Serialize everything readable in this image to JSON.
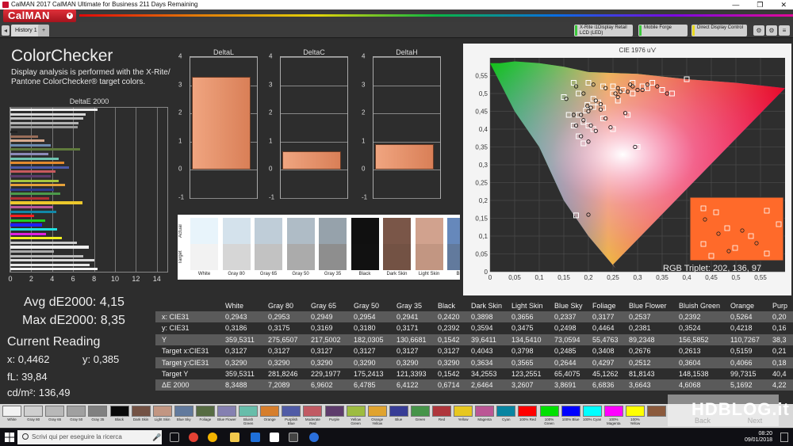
{
  "window": {
    "title": "CalMAN 2017 CalMAN Ultimate for Business 211 Days Remaining",
    "min": "—",
    "max": "❐",
    "close": "✕"
  },
  "app": {
    "logo": "CalMAN"
  },
  "tabs": [
    {
      "label": "History 1"
    },
    {
      "label": "+"
    }
  ],
  "devices": [
    {
      "label_line1": "X-Rite i1Display Retail",
      "label_line2": "LCD (LED)",
      "color": "#3cc83c"
    },
    {
      "label_line1": "Mobile Forge",
      "label_line2": "",
      "color": "#3cc83c"
    },
    {
      "label_line1": "Direct Display Control",
      "label_line2": "",
      "color": "#e8d81c"
    }
  ],
  "panel": {
    "title": "ColorChecker",
    "description": "Display analysis is performed with the X-Rite/ Pantone ColorChecker® target colors."
  },
  "de_chart": {
    "title": "DeltaE 2000",
    "xticks": [
      "0",
      "2",
      "4",
      "6",
      "8",
      "10",
      "12",
      "14"
    ],
    "xmax": 15,
    "bars": [
      {
        "value": 8.35,
        "color": "#f2f2f2"
      },
      {
        "value": 7.21,
        "color": "#d9d9d9"
      },
      {
        "value": 6.96,
        "color": "#c6c6c6"
      },
      {
        "value": 6.48,
        "color": "#b4b4b4"
      },
      {
        "value": 6.41,
        "color": "#9a9a9a"
      },
      {
        "value": 0.67,
        "color": "#222222"
      },
      {
        "value": 2.65,
        "color": "#9a6e5a"
      },
      {
        "value": 3.26,
        "color": "#d7a98f"
      },
      {
        "value": 3.87,
        "color": "#6e8bb0"
      },
      {
        "value": 6.68,
        "color": "#5f7a3c"
      },
      {
        "value": 3.66,
        "color": "#8c8ab8"
      },
      {
        "value": 4.61,
        "color": "#6fc4b0"
      },
      {
        "value": 5.17,
        "color": "#e48a2e"
      },
      {
        "value": 5.6,
        "color": "#4c5aa8"
      },
      {
        "value": 4.3,
        "color": "#c85a5e"
      },
      {
        "value": 3.9,
        "color": "#5c3c6c"
      },
      {
        "value": 4.6,
        "color": "#a6c640"
      },
      {
        "value": 5.2,
        "color": "#e6a23a"
      },
      {
        "value": 4.2,
        "color": "#2e3c8c"
      },
      {
        "value": 4.8,
        "color": "#4c9a4a"
      },
      {
        "value": 3.7,
        "color": "#b03234"
      },
      {
        "value": 6.9,
        "color": "#ecc82c"
      },
      {
        "value": 4.1,
        "color": "#bc5a98"
      },
      {
        "value": 4.4,
        "color": "#1288a8"
      },
      {
        "value": 2.3,
        "color": "#ff2020"
      },
      {
        "value": 3.3,
        "color": "#20d020"
      },
      {
        "value": 3.0,
        "color": "#2020ff"
      },
      {
        "value": 4.5,
        "color": "#20e0e0"
      },
      {
        "value": 3.4,
        "color": "#e020e0"
      },
      {
        "value": 4.9,
        "color": "#f0f020"
      },
      {
        "value": 6.4,
        "color": "#cccccc"
      },
      {
        "value": 7.5,
        "color": "#eeeeee"
      },
      {
        "value": 4.2,
        "color": "#aaaaaa"
      },
      {
        "value": 7.0,
        "color": "#bbbbbb"
      },
      {
        "value": 8.0,
        "color": "#dddddd"
      },
      {
        "value": 7.6,
        "color": "#e6e6e6"
      },
      {
        "value": 8.35,
        "color": "#f4f4f4"
      }
    ]
  },
  "stats": {
    "avg": "Avg dE2000: 4,15",
    "max": "Max dE2000: 8,35",
    "current_reading_title": "Current Reading",
    "x": "x: 0,4462",
    "y": "y: 0,385",
    "fl": "fL: 39,84",
    "cdm2": "cd/m²: 136,49"
  },
  "delta_charts": [
    {
      "title": "DeltaL",
      "value": 3.3,
      "ymin": -1,
      "ymax": 4,
      "yticks": [
        "4",
        "3",
        "2",
        "1",
        "0",
        "-1"
      ]
    },
    {
      "title": "DeltaC",
      "value": 0.65,
      "ymin": -1,
      "ymax": 4,
      "yticks": [
        "4",
        "3",
        "2",
        "1",
        "0",
        "-1"
      ]
    },
    {
      "title": "DeltaH",
      "value": 0.9,
      "ymin": -1,
      "ymax": 4,
      "yticks": [
        "4",
        "3",
        "2",
        "1",
        "0",
        "-1"
      ]
    }
  ],
  "swatches": {
    "actual_label": "Actual",
    "target_label": "Target",
    "items": [
      {
        "name": "White",
        "actual": "#e8f4fb",
        "target": "#f2f2f2"
      },
      {
        "name": "Gray 80",
        "actual": "#d4e2ec",
        "target": "#d6d6d6"
      },
      {
        "name": "Gray 65",
        "actual": "#bfcdd8",
        "target": "#c2c2c2"
      },
      {
        "name": "Gray 50",
        "actual": "#afbcc6",
        "target": "#ababab"
      },
      {
        "name": "Gray 35",
        "actual": "#96a2ab",
        "target": "#8e8e8e"
      },
      {
        "name": "Black",
        "actual": "#101010",
        "target": "#111111"
      },
      {
        "name": "Dark Skin",
        "actual": "#7a5648",
        "target": "#735244"
      },
      {
        "name": "Light Skin",
        "actual": "#d1a28e",
        "target": "#c29682"
      },
      {
        "name": "Blue",
        "actual": "#6688bb",
        "target": "#627a9d"
      }
    ]
  },
  "cie": {
    "title": "CIE 1976 u'v'",
    "xticks": [
      "0",
      "0,05",
      "0,1",
      "0,15",
      "0,2",
      "0,25",
      "0,3",
      "0,35",
      "0,4",
      "0,45",
      "0,5",
      "0,55"
    ],
    "yticks": [
      "0,55",
      "0,5",
      "0,45",
      "0,4",
      "0,35",
      "0,3",
      "0,25",
      "0,2",
      "0,15",
      "0,1",
      "0,05",
      "0"
    ],
    "xmax": 0.6,
    "ymax": 0.6,
    "rgb_triplet": "RGB Triplet: 202, 136, 97",
    "targets": [
      [
        0.198,
        0.468
      ],
      [
        0.21,
        0.462
      ],
      [
        0.195,
        0.452
      ],
      [
        0.21,
        0.485
      ],
      [
        0.22,
        0.475
      ],
      [
        0.18,
        0.44
      ],
      [
        0.19,
        0.42
      ],
      [
        0.16,
        0.44
      ],
      [
        0.17,
        0.41
      ],
      [
        0.2,
        0.41
      ],
      [
        0.23,
        0.43
      ],
      [
        0.21,
        0.4
      ],
      [
        0.18,
        0.38
      ],
      [
        0.19,
        0.36
      ],
      [
        0.25,
        0.5
      ],
      [
        0.27,
        0.51
      ],
      [
        0.23,
        0.52
      ],
      [
        0.29,
        0.53
      ],
      [
        0.32,
        0.515
      ],
      [
        0.35,
        0.51
      ],
      [
        0.4,
        0.54
      ],
      [
        0.15,
        0.49
      ],
      [
        0.17,
        0.53
      ],
      [
        0.26,
        0.48
      ],
      [
        0.29,
        0.5
      ],
      [
        0.31,
        0.52
      ],
      [
        0.33,
        0.53
      ],
      [
        0.37,
        0.5
      ],
      [
        0.25,
        0.52
      ],
      [
        0.2,
        0.53
      ],
      [
        0.18,
        0.5
      ],
      [
        0.28,
        0.44
      ],
      [
        0.3,
        0.35
      ],
      [
        0.25,
        0.4
      ],
      [
        0.23,
        0.46
      ],
      [
        0.175,
        0.158
      ]
    ],
    "measured": [
      [
        0.198,
        0.465
      ],
      [
        0.205,
        0.46
      ],
      [
        0.2,
        0.45
      ],
      [
        0.215,
        0.48
      ],
      [
        0.225,
        0.47
      ],
      [
        0.185,
        0.44
      ],
      [
        0.19,
        0.425
      ],
      [
        0.17,
        0.44
      ],
      [
        0.175,
        0.41
      ],
      [
        0.205,
        0.41
      ],
      [
        0.235,
        0.43
      ],
      [
        0.215,
        0.395
      ],
      [
        0.185,
        0.38
      ],
      [
        0.2,
        0.365
      ],
      [
        0.255,
        0.5
      ],
      [
        0.265,
        0.505
      ],
      [
        0.235,
        0.515
      ],
      [
        0.285,
        0.525
      ],
      [
        0.3,
        0.51
      ],
      [
        0.31,
        0.51
      ],
      [
        0.34,
        0.52
      ],
      [
        0.155,
        0.485
      ],
      [
        0.175,
        0.52
      ],
      [
        0.26,
        0.49
      ],
      [
        0.28,
        0.505
      ],
      [
        0.29,
        0.52
      ],
      [
        0.32,
        0.525
      ],
      [
        0.36,
        0.5
      ],
      [
        0.26,
        0.515
      ],
      [
        0.21,
        0.525
      ],
      [
        0.19,
        0.5
      ],
      [
        0.275,
        0.445
      ],
      [
        0.295,
        0.35
      ],
      [
        0.245,
        0.405
      ],
      [
        0.225,
        0.455
      ],
      [
        0.2,
        0.16
      ]
    ]
  },
  "table": {
    "columns": [
      "",
      "White",
      "Gray 80",
      "Gray 65",
      "Gray 50",
      "Gray 35",
      "Black",
      "Dark Skin",
      "Light Skin",
      "Blue Sky",
      "Foliage",
      "Blue Flower",
      "Bluish Green",
      "Orange",
      "Purp"
    ],
    "rows": [
      [
        "x: CIE31",
        "0,2943",
        "0,2953",
        "0,2949",
        "0,2954",
        "0,2941",
        "0,2420",
        "0,3898",
        "0,3656",
        "0,2337",
        "0,3177",
        "0,2537",
        "0,2392",
        "0,5264",
        "0,20"
      ],
      [
        "y: CIE31",
        "0,3186",
        "0,3175",
        "0,3169",
        "0,3180",
        "0,3171",
        "0,2392",
        "0,3594",
        "0,3475",
        "0,2498",
        "0,4464",
        "0,2381",
        "0,3524",
        "0,4218",
        "0,16"
      ],
      [
        "Y",
        "359,5311",
        "275,6507",
        "217,5002",
        "182,0305",
        "130,6681",
        "0,1542",
        "39,6411",
        "134,5410",
        "73,0594",
        "55,4763",
        "89,2348",
        "156,5852",
        "110,7267",
        "38,3"
      ],
      [
        "Target x:CIE31",
        "0,3127",
        "0,3127",
        "0,3127",
        "0,3127",
        "0,3127",
        "0,3127",
        "0,4043",
        "0,3798",
        "0,2485",
        "0,3408",
        "0,2676",
        "0,2613",
        "0,5159",
        "0,21"
      ],
      [
        "Target y:CIE31",
        "0,3290",
        "0,3290",
        "0,3290",
        "0,3290",
        "0,3290",
        "0,3290",
        "0,3634",
        "0,3565",
        "0,2644",
        "0,4297",
        "0,2512",
        "0,3604",
        "0,4066",
        "0,18"
      ],
      [
        "Target Y",
        "359,5311",
        "281,8246",
        "229,1977",
        "175,2413",
        "121,3393",
        "0,1542",
        "34,2553",
        "123,2551",
        "65,4075",
        "45,1262",
        "81,8143",
        "148,1538",
        "99,7315",
        "40,4"
      ],
      [
        "ΔE 2000",
        "8,3488",
        "7,2089",
        "6,9602",
        "6,4785",
        "6,4122",
        "0,6714",
        "2,6464",
        "3,2607",
        "3,8691",
        "6,6836",
        "3,6643",
        "4,6068",
        "5,1692",
        "4,22"
      ]
    ]
  },
  "palette": [
    {
      "name": "White",
      "color": "#f2f2f2"
    },
    {
      "name": "Gray 80",
      "color": "#cfcfcf"
    },
    {
      "name": "Gray 65",
      "color": "#b8b8b8"
    },
    {
      "name": "Gray 50",
      "color": "#a0a0a0"
    },
    {
      "name": "Gray 35",
      "color": "#808080"
    },
    {
      "name": "Black",
      "color": "#0a0a0a"
    },
    {
      "name": "Dark Skin",
      "color": "#735244"
    },
    {
      "name": "Light Skin",
      "color": "#c29682"
    },
    {
      "name": "Blue Sky",
      "color": "#627a9d"
    },
    {
      "name": "Foliage",
      "color": "#576c43"
    },
    {
      "name": "Blue Flower",
      "color": "#8580b1"
    },
    {
      "name": "Bluish Green",
      "color": "#67bdaa"
    },
    {
      "name": "Orange",
      "color": "#d67e2c"
    },
    {
      "name": "Purplish Blue",
      "color": "#505ba6"
    },
    {
      "name": "Moderate Red",
      "color": "#c15a63"
    },
    {
      "name": "Purple",
      "color": "#5e3c6c"
    },
    {
      "name": "Yellow Green",
      "color": "#9dbc40"
    },
    {
      "name": "Orange Yellow",
      "color": "#e0a32e"
    },
    {
      "name": "Blue",
      "color": "#383d96"
    },
    {
      "name": "Green",
      "color": "#469449"
    },
    {
      "name": "Red",
      "color": "#af363c"
    },
    {
      "name": "Yellow",
      "color": "#e7c71f"
    },
    {
      "name": "Magenta",
      "color": "#bb5695"
    },
    {
      "name": "Cyan",
      "color": "#0885a1"
    },
    {
      "name": "100% Red",
      "color": "#ff0000"
    },
    {
      "name": "100% Green",
      "color": "#00e000"
    },
    {
      "name": "100% Blue",
      "color": "#0000ff"
    },
    {
      "name": "100% Cyan",
      "color": "#00ffff"
    },
    {
      "name": "100% Magenta",
      "color": "#ff00ff"
    },
    {
      "name": "100% Yellow",
      "color": "#ffff00"
    },
    {
      "name": "",
      "color": "#8b5a3c"
    }
  ],
  "nav": {
    "back": "Back",
    "next": "Next"
  },
  "watermark": "HDBLOG.it",
  "taskbar": {
    "search_placeholder": "Scrivi qui per eseguire la ricerca",
    "time": "08:20",
    "date": "09/01/2018"
  }
}
